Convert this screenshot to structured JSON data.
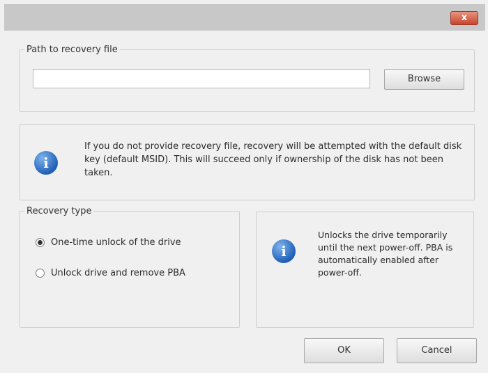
{
  "window": {
    "close_glyph": "x"
  },
  "path_group": {
    "legend": "Path to recovery file",
    "input_value": "",
    "browse_label": "Browse"
  },
  "main_info": {
    "icon": "info-icon",
    "text": "If you do not provide recovery file, recovery will be attempted with the default disk key (default MSID). This will succeed only if ownership of the disk has not been taken."
  },
  "recovery_type": {
    "legend": "Recovery type",
    "options": [
      {
        "label": "One-time unlock of the drive",
        "selected": true
      },
      {
        "label": "Unlock drive and remove PBA",
        "selected": false
      }
    ]
  },
  "side_info": {
    "icon": "info-icon",
    "text": "Unlocks the drive temporarily until the next power-off. PBA is automatically enabled after power-off."
  },
  "buttons": {
    "ok": "OK",
    "cancel": "Cancel"
  },
  "colors": {
    "close_button": "#c9432d",
    "info_icon": "#1f5fb8",
    "dialog_bg": "#f0f0f0"
  }
}
